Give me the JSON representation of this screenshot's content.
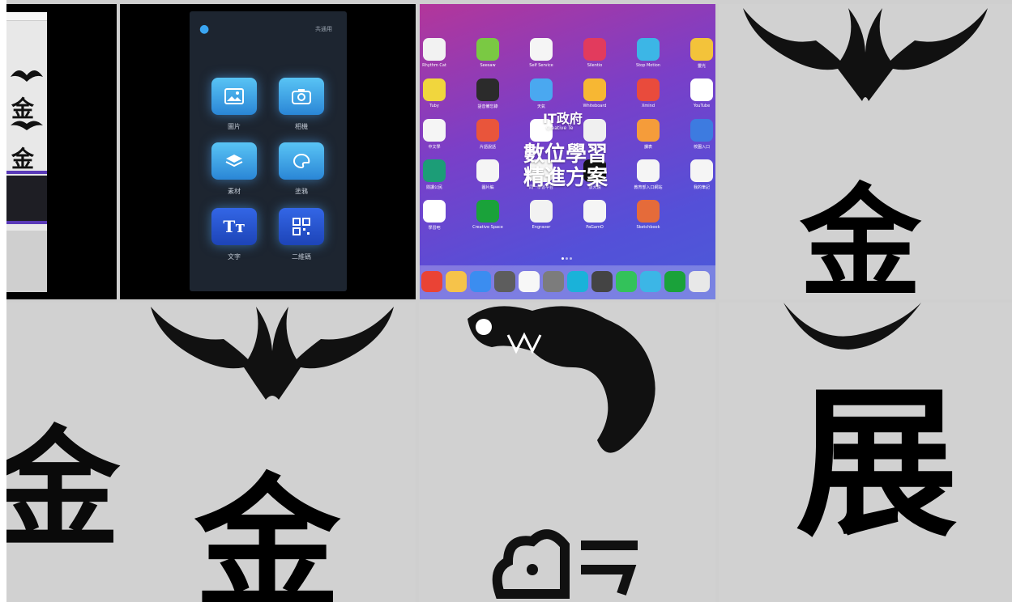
{
  "tiles": {
    "strip": {
      "glyph_1": "金",
      "glyph_2": "金"
    },
    "phone": {
      "top_right": "共通用",
      "apps": [
        {
          "label": "圖片",
          "icon": "image-icon"
        },
        {
          "label": "相機",
          "icon": "camera-icon"
        },
        {
          "label": "素材",
          "icon": "layers-icon"
        },
        {
          "label": "塗鴉",
          "icon": "palette-icon"
        },
        {
          "label": "文字",
          "icon": "text-icon",
          "glyph": "Tт"
        },
        {
          "label": "二維碼",
          "icon": "qr-code-icon"
        }
      ]
    },
    "tablet": {
      "overlay_line1": "IT政府",
      "overlay_sub": "Creative Te",
      "overlay_line2": "數位學習",
      "overlay_line3": "精進方案",
      "apps": [
        {
          "label": "Rhythm Cat",
          "color": "#f2f2f2"
        },
        {
          "label": "Seesaw",
          "color": "#7ac943"
        },
        {
          "label": "Self Service",
          "color": "#f5f5f5"
        },
        {
          "label": "Silentio",
          "color": "#e23b5d"
        },
        {
          "label": "Stop Motion",
          "color": "#3cb6e6"
        },
        {
          "label": "靈光",
          "color": "#f3c33a"
        },
        {
          "label": "Tuby",
          "color": "#f1d63d"
        },
        {
          "label": "語音備忘錄",
          "color": "#2b2b2b"
        },
        {
          "label": "天氣",
          "color": "#4aa8f0"
        },
        {
          "label": "Whiteboard",
          "color": "#f7b733"
        },
        {
          "label": "Xmind",
          "color": "#e94b3c"
        },
        {
          "label": "YouTube",
          "color": "#ffffff"
        },
        {
          "label": "中文學",
          "color": "#f5f5f5"
        },
        {
          "label": "片語說話",
          "color": "#e9553b"
        },
        {
          "label": "",
          "color": "#ffffff"
        },
        {
          "label": "",
          "color": "#f0f0f0"
        },
        {
          "label": "課表",
          "color": "#f59c3a"
        },
        {
          "label": "校園入口",
          "color": "#3d7be0"
        },
        {
          "label": "閱讀公民",
          "color": "#1c9d77"
        },
        {
          "label": "圖片編",
          "color": "#f5f5f5"
        },
        {
          "label": "同一學習平台",
          "color": "#f5f5f5"
        },
        {
          "label": "放大鏡",
          "color": "#111111"
        },
        {
          "label": "教育部入口網站",
          "color": "#f5f5f5"
        },
        {
          "label": "我的筆記",
          "color": "#f5f5f5"
        },
        {
          "label": "學習吧",
          "color": "#ffffff"
        },
        {
          "label": "Creative Space",
          "color": "#1aa23a"
        },
        {
          "label": "Engraver",
          "color": "#f2f2f2"
        },
        {
          "label": "PaGamO",
          "color": "#f5f5f5"
        },
        {
          "label": "Sketchbook",
          "color": "#e56b3a"
        }
      ],
      "dock": [
        {
          "color": "#ea4335"
        },
        {
          "color": "#f6c34a"
        },
        {
          "color": "#3b8df0"
        },
        {
          "color": "#5d5d5d"
        },
        {
          "color": "#f7f7f7"
        },
        {
          "color": "#7c7c7c"
        },
        {
          "color": "#1ab2d9"
        },
        {
          "color": "#444"
        },
        {
          "color": "#33c25a"
        },
        {
          "color": "#3cb6e6"
        },
        {
          "color": "#1aa23a"
        },
        {
          "color": "#e8e8e8"
        }
      ]
    },
    "glyphs": {
      "gold_right": "金",
      "gold_bottom": "金",
      "zhan": "展",
      "left_partial": "金"
    }
  }
}
